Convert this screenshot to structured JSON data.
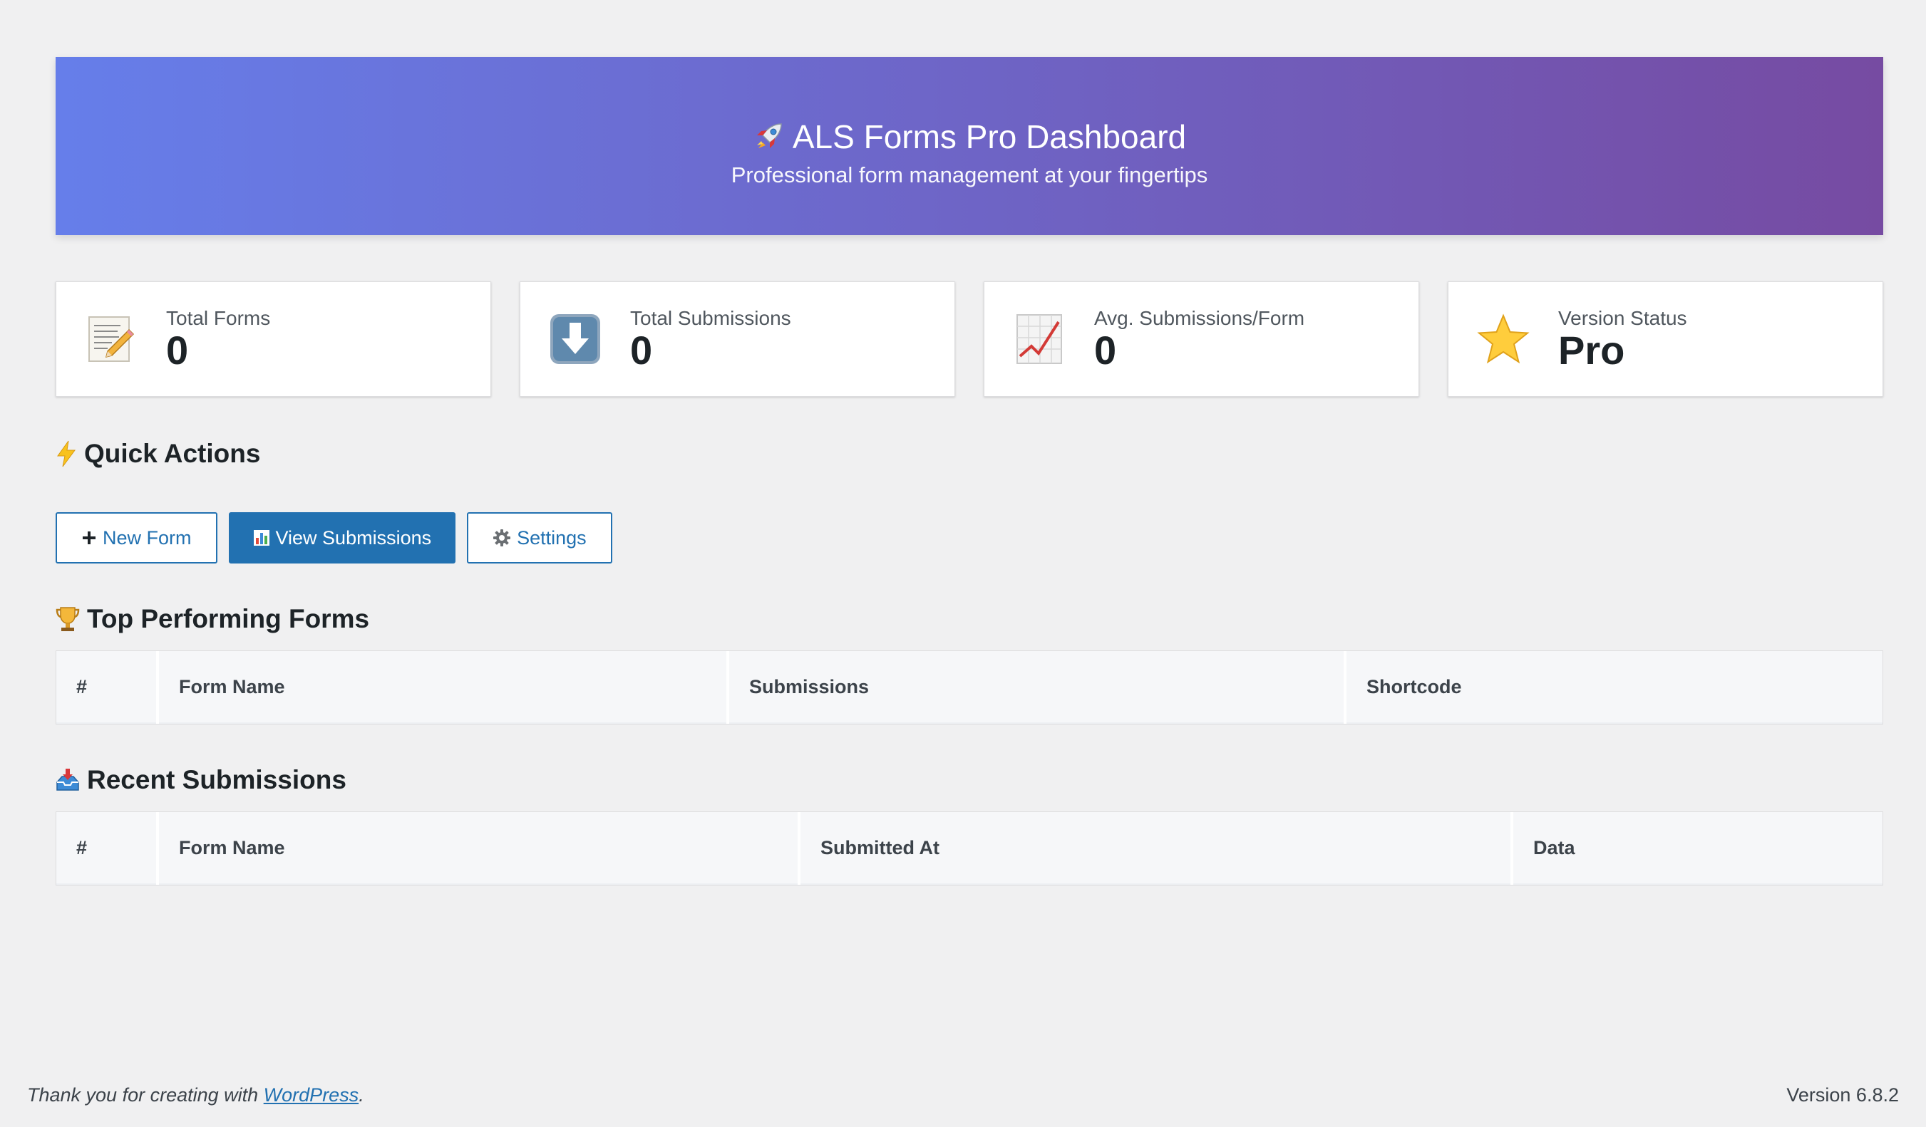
{
  "hero": {
    "title": "ALS Forms Pro Dashboard",
    "subtitle": "Professional form management at your fingertips",
    "icon": "rocket-icon"
  },
  "stats": [
    {
      "label": "Total Forms",
      "value": "0",
      "icon": "memo-icon"
    },
    {
      "label": "Total Submissions",
      "value": "0",
      "icon": "down-arrow-icon"
    },
    {
      "label": "Avg. Submissions/Form",
      "value": "0",
      "icon": "chart-increasing-icon"
    },
    {
      "label": "Version Status",
      "value": "Pro",
      "icon": "star-icon"
    }
  ],
  "quick_actions": {
    "title": "Quick Actions",
    "icon": "lightning-icon",
    "buttons": [
      {
        "label": "New Form",
        "icon": "plus-icon"
      },
      {
        "label": "View Submissions",
        "icon": "bar-chart-icon"
      },
      {
        "label": "Settings",
        "icon": "gear-icon"
      }
    ]
  },
  "top_forms": {
    "title": "Top Performing Forms",
    "icon": "trophy-icon",
    "columns": [
      "#",
      "Form Name",
      "Submissions",
      "Shortcode"
    ]
  },
  "recent_submissions": {
    "title": "Recent Submissions",
    "icon": "inbox-tray-icon",
    "columns": [
      "#",
      "Form Name",
      "Submitted At",
      "Data"
    ]
  },
  "footer": {
    "thanks_prefix": "Thank you for creating with ",
    "link_text": "WordPress",
    "thanks_suffix": ".",
    "version": "Version 6.8.2"
  },
  "colors": {
    "gradient_start": "#667eea",
    "gradient_end": "#764ba2",
    "primary": "#2271b1",
    "background": "#f0f0f1"
  }
}
